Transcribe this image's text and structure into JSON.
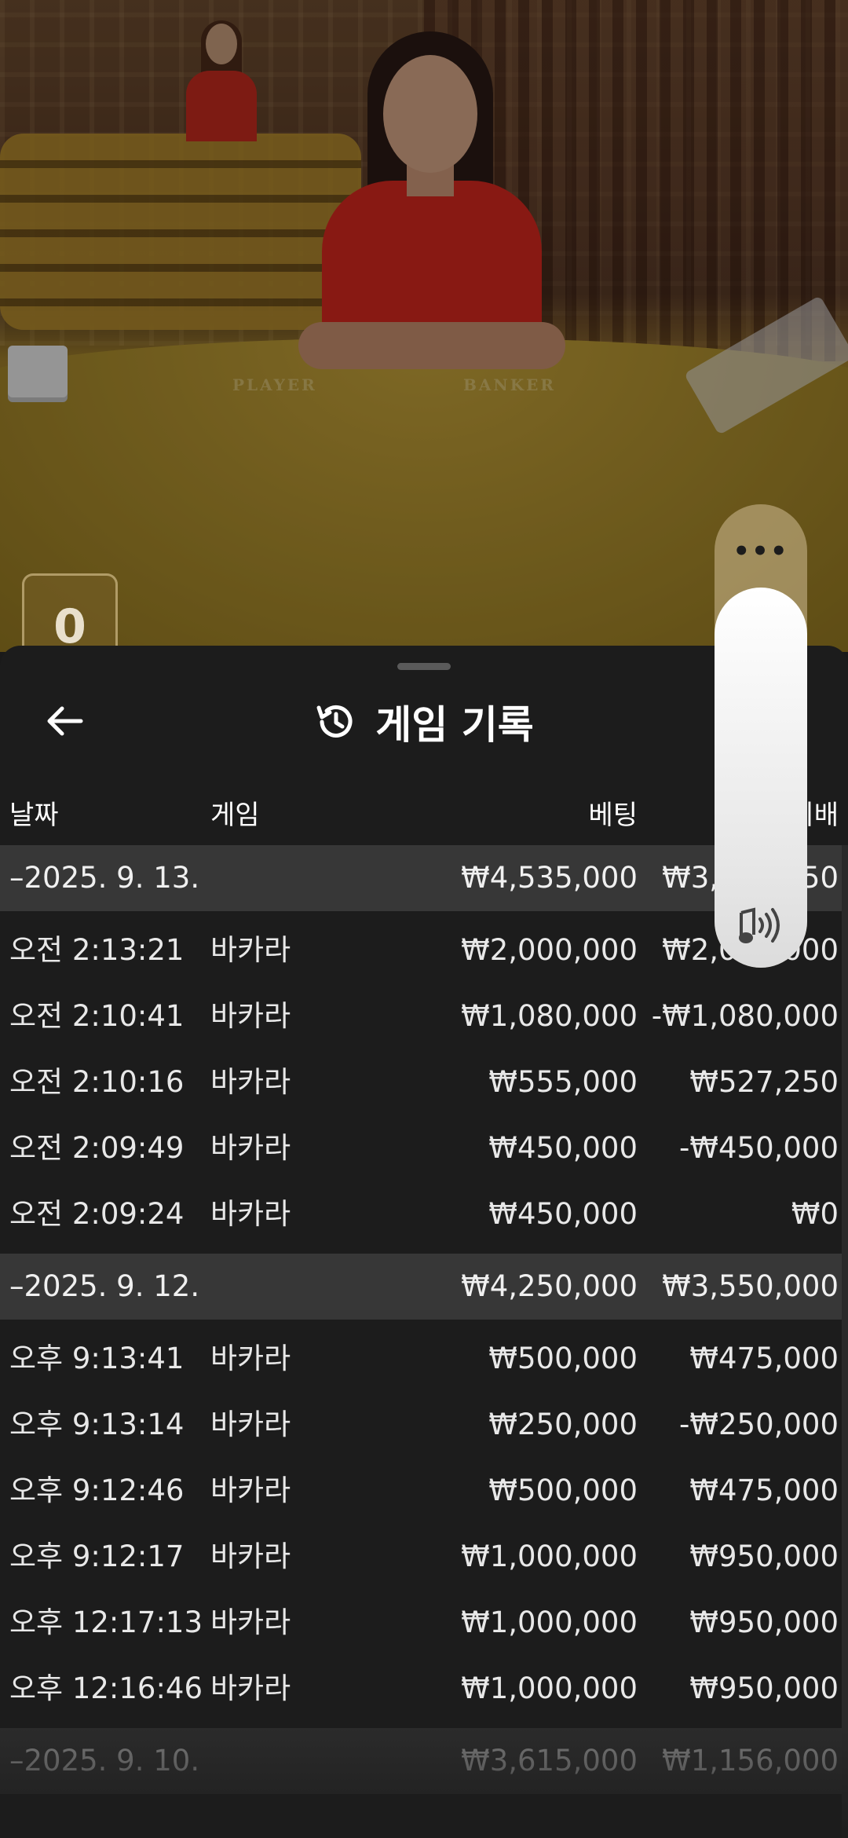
{
  "video": {
    "table_labels": [
      "PLAYER",
      "BANKER"
    ],
    "counter_value": "0"
  },
  "sheet": {
    "title": "게임 기록",
    "columns": {
      "date": "날짜",
      "game": "게임",
      "bet": "베팅",
      "payout": "지배"
    },
    "groups": [
      {
        "date": "–2025. 9. 13.",
        "bet": "₩4,535,000",
        "payout": "₩3,902,250",
        "rows": [
          {
            "time": "오전 2:13:21",
            "game": "바카라",
            "bet": "₩2,000,000",
            "payout": "₩2,000,000"
          },
          {
            "time": "오전 2:10:41",
            "game": "바카라",
            "bet": "₩1,080,000",
            "payout": "-₩1,080,000"
          },
          {
            "time": "오전 2:10:16",
            "game": "바카라",
            "bet": "₩555,000",
            "payout": "₩527,250"
          },
          {
            "time": "오전 2:09:49",
            "game": "바카라",
            "bet": "₩450,000",
            "payout": "-₩450,000"
          },
          {
            "time": "오전 2:09:24",
            "game": "바카라",
            "bet": "₩450,000",
            "payout": "₩0"
          }
        ]
      },
      {
        "date": "–2025. 9. 12.",
        "bet": "₩4,250,000",
        "payout": "₩3,550,000",
        "rows": [
          {
            "time": "오후 9:13:41",
            "game": "바카라",
            "bet": "₩500,000",
            "payout": "₩475,000"
          },
          {
            "time": "오후 9:13:14",
            "game": "바카라",
            "bet": "₩250,000",
            "payout": "-₩250,000"
          },
          {
            "time": "오후 9:12:46",
            "game": "바카라",
            "bet": "₩500,000",
            "payout": "₩475,000"
          },
          {
            "time": "오후 9:12:17",
            "game": "바카라",
            "bet": "₩1,000,000",
            "payout": "₩950,000"
          },
          {
            "time": "오후 12:17:13",
            "game": "바카라",
            "bet": "₩1,000,000",
            "payout": "₩950,000"
          },
          {
            "time": "오후 12:16:46",
            "game": "바카라",
            "bet": "₩1,000,000",
            "payout": "₩950,000"
          }
        ]
      },
      {
        "date": "–2025. 9. 10.",
        "bet": "₩3,615,000",
        "payout": "₩1,156,000",
        "rows": []
      }
    ]
  },
  "volume": {
    "more_label": "•••",
    "level": 0.82,
    "icon": "speaker-sound-icon"
  },
  "colors": {
    "sheet_bg": "#1c1c1c",
    "group_bg": "#373737",
    "text": "#e8e8e8"
  }
}
